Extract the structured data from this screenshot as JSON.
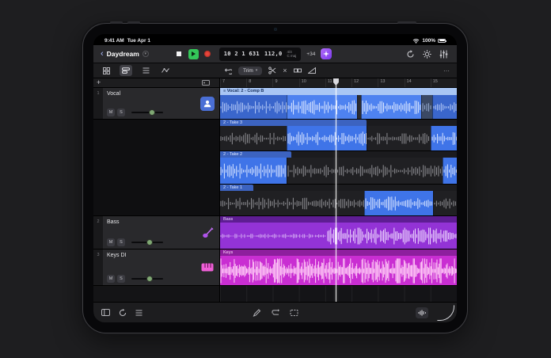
{
  "status": {
    "time": "9:41 AM",
    "date": "Tue Apr 1",
    "battery_pct": "100%"
  },
  "toolbar": {
    "title": "Daydream",
    "lcd": {
      "position": "10 2 1 631",
      "tempo": "112,0",
      "sig": "4/4",
      "key": "C maj"
    },
    "transpose": "+34"
  },
  "edit_toolbar": {
    "tool_label": "Trim"
  },
  "controls": {
    "mute": "M",
    "solo": "S"
  },
  "ruler": {
    "bars": [
      "7",
      "8",
      "9",
      "10",
      "11",
      "12",
      "13",
      "14",
      "15"
    ]
  },
  "tracks": [
    {
      "num": "1",
      "name": "Vocal"
    },
    {
      "num": "2",
      "name": "Bass"
    },
    {
      "num": "3",
      "name": "Keys DI"
    }
  ],
  "regions": {
    "comp": {
      "label": "Vocal: 2 - Comp B"
    },
    "takes": [
      {
        "label": "2 - Take 3"
      },
      {
        "label": "2 - Take 2"
      },
      {
        "label": "2 - Take 1"
      }
    ],
    "bass": {
      "label": "Bass"
    },
    "keys": {
      "label": "Keys"
    }
  },
  "icons": {
    "back": "‹",
    "menu": "▾",
    "plus": "+",
    "comp": "≡",
    "close": "×",
    "ellipsis": "⋯"
  },
  "colors": {
    "accent_blue": "#4a80ef",
    "take_blue": "#3e6fd8",
    "selected_blue": "#4e82f0",
    "comp_header": "#a9c6f4",
    "bass_purple": "#9333d6",
    "keys_magenta": "#c92ed2",
    "play_green": "#34c759",
    "record_red": "#e8463c",
    "session_purple": "#8e44ec"
  }
}
